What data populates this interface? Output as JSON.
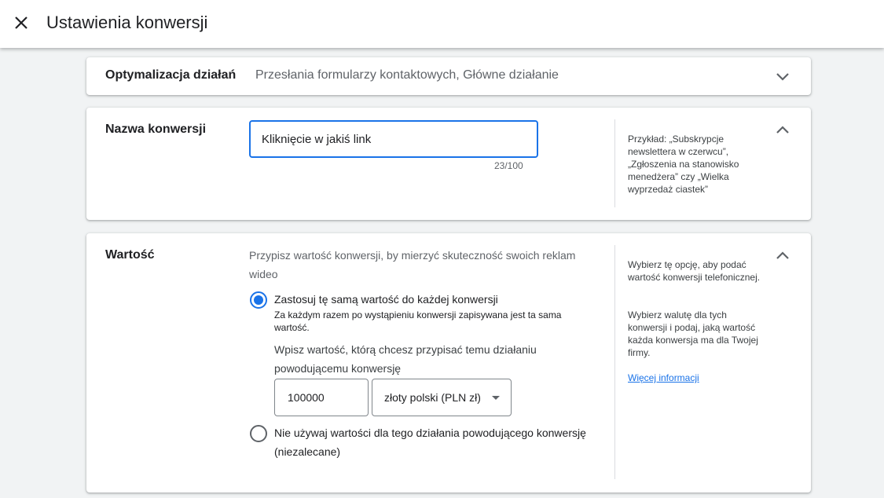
{
  "header": {
    "title": "Ustawienia konwersji",
    "close_icon": "close-icon"
  },
  "goal_section": {
    "label": "Optymalizacja działań",
    "summary": "Przesłania formularzy kontaktowych, Główne działanie",
    "toggle_icon": "chevron-down-icon"
  },
  "name_section": {
    "label": "Nazwa konwersji",
    "input_value": "Kliknięcie w jakiś link",
    "counter": "23/100",
    "help": "Przykład: „Subskrypcje newslettera w czerwcu”, „Zgłoszenia na stanowisko menedżera” czy „Wielka wyprzedaż ciastek”",
    "toggle_icon": "chevron-up-icon"
  },
  "value_section": {
    "label": "Wartość",
    "description": "Przypisz wartość konwersji, by mierzyć skuteczność swoich reklam wideo",
    "option_same": {
      "title": "Zastosuj tę samą wartość do każdej konwersji",
      "subtitle": "Za każdym razem po wystąpieniu konwersji zapisywana jest ta sama wartość.",
      "selected": true
    },
    "value_prompt": "Wpisz wartość, którą chcesz przypisać temu działaniu powodującemu konwersję",
    "value_input": "100000",
    "currency": "złoty polski (PLN zł)",
    "option_none": {
      "title": "Nie używaj wartości dla tego działania powodującego konwersję (niezalecane)",
      "selected": false
    },
    "help_1": "Wybierz tę opcję, aby podać wartość konwersji telefonicznej.",
    "help_2": "Wybierz walutę dla tych konwersji i podaj, jaką wartość każda konwersja ma dla Twojej firmy.",
    "learn_more": "Więcej informacji",
    "toggle_icon": "chevron-up-icon"
  },
  "colors": {
    "accent": "#1a73e8",
    "text": "#202124",
    "secondary_text": "#5f6368",
    "background": "#f1f3f4"
  }
}
